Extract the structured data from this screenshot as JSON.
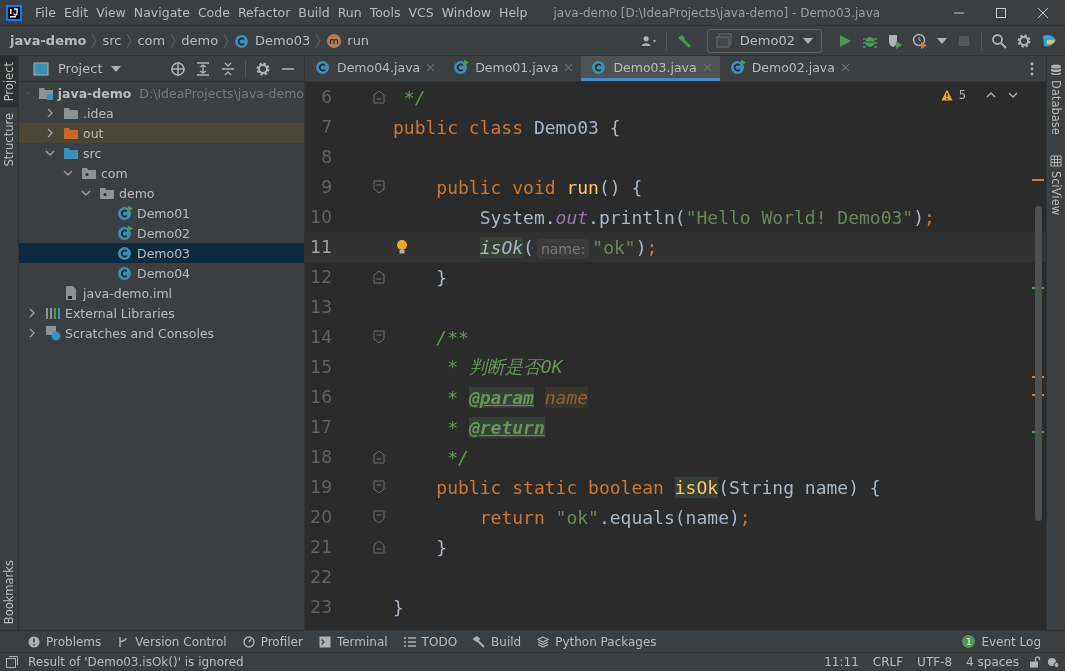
{
  "window": {
    "title": "java-demo [D:\\IdeaProjects\\java-demo] - Demo03.java"
  },
  "menu": [
    "File",
    "Edit",
    "View",
    "Navigate",
    "Code",
    "Refactor",
    "Build",
    "Run",
    "Tools",
    "VCS",
    "Window",
    "Help"
  ],
  "breadcrumbs": [
    {
      "label": "java-demo",
      "kind": "project"
    },
    {
      "label": "src",
      "kind": "folder"
    },
    {
      "label": "com",
      "kind": "folder"
    },
    {
      "label": "demo",
      "kind": "folder"
    },
    {
      "label": "Demo03",
      "kind": "class"
    },
    {
      "label": "run",
      "kind": "method"
    }
  ],
  "run_config": {
    "label": "Demo02",
    "stop_enabled": false
  },
  "left_stripe": [
    {
      "label": "Project",
      "selected": true
    },
    {
      "label": "Structure",
      "selected": false
    }
  ],
  "left_stripe_bottom": [
    {
      "label": "Bookmarks",
      "selected": false
    }
  ],
  "right_stripe": [
    {
      "label": "Database",
      "kind": "database"
    },
    {
      "label": "SciView",
      "kind": "sciview"
    }
  ],
  "project_panel": {
    "title": "Project",
    "tree": [
      {
        "label": "java-demo",
        "path": "D:\\IdeaProjects\\java-demo",
        "kind": "project",
        "expanded": true,
        "selected": false,
        "children": [
          {
            "label": ".idea",
            "kind": "folder",
            "expanded": false,
            "selected": false
          },
          {
            "label": "out",
            "kind": "excluded",
            "expanded": false,
            "selected": false
          },
          {
            "label": "src",
            "kind": "source",
            "expanded": true,
            "selected": false,
            "children": [
              {
                "label": "com",
                "kind": "package",
                "expanded": true,
                "selected": false,
                "children": [
                  {
                    "label": "demo",
                    "kind": "package",
                    "expanded": true,
                    "selected": false,
                    "children": [
                      {
                        "label": "Demo01",
                        "kind": "class",
                        "runnable": true,
                        "selected": false
                      },
                      {
                        "label": "Demo02",
                        "kind": "class",
                        "runnable": true,
                        "selected": false
                      },
                      {
                        "label": "Demo03",
                        "kind": "class",
                        "runnable": false,
                        "selected": true
                      },
                      {
                        "label": "Demo04",
                        "kind": "class",
                        "runnable": false,
                        "selected": false
                      }
                    ]
                  }
                ]
              }
            ]
          },
          {
            "label": "java-demo.iml",
            "kind": "file",
            "selected": false
          }
        ]
      },
      {
        "label": "External Libraries",
        "kind": "libraries",
        "expanded": false,
        "selected": false
      },
      {
        "label": "Scratches and Consoles",
        "kind": "scratches",
        "expanded": false,
        "selected": false
      }
    ]
  },
  "editor_tabs": [
    {
      "label": "Demo04.java",
      "runnable": false,
      "selected": false
    },
    {
      "label": "Demo01.java",
      "runnable": true,
      "selected": false
    },
    {
      "label": "Demo03.java",
      "runnable": false,
      "selected": true
    },
    {
      "label": "Demo02.java",
      "runnable": true,
      "selected": false
    }
  ],
  "editor": {
    "problems": "5",
    "lines": [
      {
        "number": "6",
        "current": false,
        "fold_open": false,
        "tokens": [
          {
            "text": " */",
            "kind": "comment"
          }
        ]
      },
      {
        "number": "7",
        "current": false,
        "tokens": [
          {
            "text": "public class ",
            "kind": "keyword"
          },
          {
            "text": "Demo03 {",
            "kind": "plain"
          }
        ]
      },
      {
        "number": "8",
        "current": false
      },
      {
        "number": "9",
        "current": false,
        "fold_open": true,
        "tokens": [
          {
            "text": "    public void ",
            "kind": "keyword"
          },
          {
            "text": "run",
            "kind": "method"
          },
          {
            "text": "() {",
            "kind": "plain"
          }
        ]
      },
      {
        "number": "10",
        "current": false,
        "tokens": [
          {
            "text": "        System.",
            "kind": "plain"
          },
          {
            "text": "out",
            "kind": "field"
          },
          {
            "text": ".println(",
            "kind": "plain"
          },
          {
            "text": "\"Hello World! Demo03\"",
            "kind": "string"
          },
          {
            "text": ")",
            "kind": "plain"
          },
          {
            "text": ";",
            "kind": "keyword"
          }
        ]
      },
      {
        "number": "11",
        "current": true,
        "bulb": true,
        "tokens": [
          {
            "text": "        isOk",
            "kind": "usage"
          },
          {
            "text": "(",
            "kind": "plain"
          },
          {
            "text": "name:",
            "kind": "hint"
          },
          {
            "text": "\"ok\"",
            "kind": "string"
          },
          {
            "text": ")",
            "kind": "plain"
          },
          {
            "text": ";",
            "kind": "keyword"
          }
        ]
      },
      {
        "number": "12",
        "current": false,
        "fold_open": false,
        "tokens": [
          {
            "text": "    }",
            "kind": "plain"
          }
        ]
      },
      {
        "number": "13",
        "current": false
      },
      {
        "number": "14",
        "current": false,
        "fold_open": true,
        "tokens": [
          {
            "text": "    /**",
            "kind": "comment"
          }
        ]
      },
      {
        "number": "15",
        "current": false,
        "tokens": [
          {
            "text": "     * 判断是否OK",
            "kind": "comment"
          }
        ]
      },
      {
        "number": "16",
        "current": false,
        "tokens": [
          {
            "text": "     * ",
            "kind": "comment"
          },
          {
            "text": "@param",
            "kind": "doctag"
          },
          {
            "text": " name",
            "kind": "docparam"
          }
        ]
      },
      {
        "number": "17",
        "current": false,
        "tokens": [
          {
            "text": "     * ",
            "kind": "comment"
          },
          {
            "text": "@return",
            "kind": "doctag"
          }
        ]
      },
      {
        "number": "18",
        "current": false,
        "fold_open": false,
        "tokens": [
          {
            "text": "     */",
            "kind": "comment"
          }
        ]
      },
      {
        "number": "19",
        "current": false,
        "fold_open": true,
        "tokens": [
          {
            "text": "    public static boolean ",
            "kind": "keyword"
          },
          {
            "text": "isOk",
            "kind": "declaration"
          },
          {
            "text": "(String name) {",
            "kind": "plain"
          }
        ]
      },
      {
        "number": "20",
        "current": false,
        "fold_open": true,
        "tokens": [
          {
            "text": "        return ",
            "kind": "keyword"
          },
          {
            "text": "\"ok\"",
            "kind": "string"
          },
          {
            "text": ".equals(name)",
            "kind": "plain"
          },
          {
            "text": ";",
            "kind": "keyword"
          }
        ]
      },
      {
        "number": "21",
        "current": false,
        "fold_open": false,
        "tokens": [
          {
            "text": "    }",
            "kind": "plain"
          }
        ]
      },
      {
        "number": "22",
        "current": false
      },
      {
        "number": "23",
        "current": false,
        "tokens": [
          {
            "text": "}",
            "kind": "plain"
          }
        ]
      }
    ]
  },
  "bottom_tools": [
    {
      "label": "Problems",
      "kind": "problems"
    },
    {
      "label": "Version Control",
      "kind": "vcs"
    },
    {
      "label": "Profiler",
      "kind": "profiler"
    },
    {
      "label": "Terminal",
      "kind": "terminal"
    },
    {
      "label": "TODO",
      "kind": "todo"
    },
    {
      "label": "Build",
      "kind": "build"
    },
    {
      "label": "Python Packages",
      "kind": "packages"
    }
  ],
  "event_log": {
    "label": "Event Log",
    "badge": "1"
  },
  "status_bar": {
    "message": "Result of 'Demo03.isOk()' is ignored",
    "items": [
      "11:11",
      "CRLF",
      "UTF-8",
      "4 spaces"
    ]
  }
}
